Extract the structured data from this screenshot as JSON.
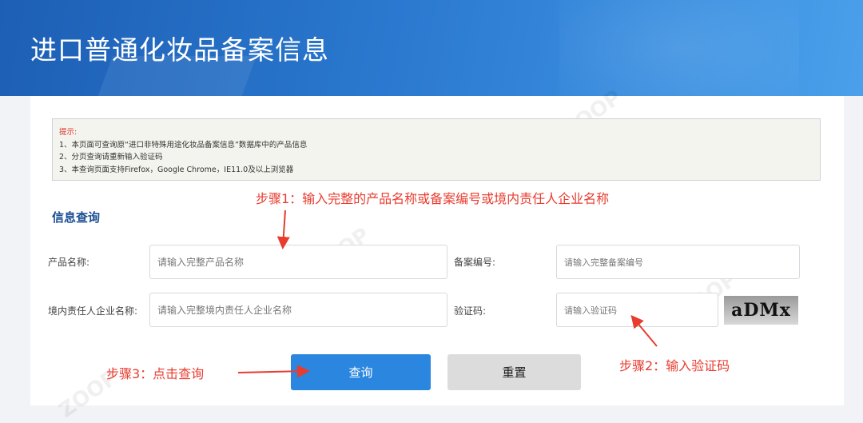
{
  "header": {
    "title": "进口普通化妆品备案信息"
  },
  "notice": {
    "hint": "提示:",
    "lines": [
      "1、本页面可查询原“进口非特殊用途化妆品备案信息”数据库中的产品信息",
      "2、分页查询请重新输入验证码",
      "3、本查询页面支持Firefox，Google Chrome，IE11.0及以上浏览器"
    ]
  },
  "section": {
    "title": "信息查询"
  },
  "form": {
    "product_name_label": "产品名称:",
    "product_name_placeholder": "请输入完整产品名称",
    "record_no_label": "备案编号:",
    "record_no_placeholder": "请输入完整备案编号",
    "company_label": "境内责任人企业名称:",
    "company_placeholder": "请输入完整境内责任人企业名称",
    "captcha_label": "验证码:",
    "captcha_placeholder": "请输入验证码",
    "captcha_text": "aDMx"
  },
  "buttons": {
    "query": "查询",
    "reset": "重置"
  },
  "annotations": {
    "step1": "步骤1：输入完整的产品名称或备案编号或境内责任人企业名称",
    "step2": "步骤2：输入验证码",
    "step3": "步骤3：点击查询",
    "color": "#e83c2f"
  },
  "watermark": "ZOOP"
}
